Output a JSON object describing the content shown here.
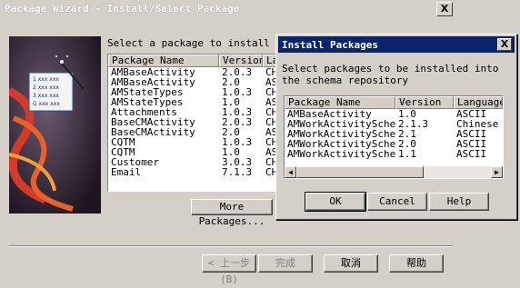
{
  "wizard": {
    "title": "Package Wizard - Install/Select Package",
    "prompt": "Select a package to install into your",
    "columns": [
      "Package Name",
      "Version",
      "La"
    ],
    "rows": [
      [
        "AMBaseActivity",
        "2.0.3",
        "CH"
      ],
      [
        "AMBaseActivity",
        "2.0",
        "AS"
      ],
      [
        "AMStateTypes",
        "1.0.3",
        "CH"
      ],
      [
        "AMStateTypes",
        "1.0",
        "AS"
      ],
      [
        "Attachments",
        "1.0.3",
        "CH"
      ],
      [
        "BaseCMActivity",
        "2.0.3",
        "CH"
      ],
      [
        "BaseCMActivity",
        "2.0",
        "AS"
      ],
      [
        "CQTM",
        "1.0.3",
        "CH"
      ],
      [
        "CQTM",
        "1.0",
        "AS"
      ],
      [
        "Customer",
        "3.0.3",
        "CH"
      ],
      [
        "Email",
        "7.1.3",
        "CH"
      ]
    ],
    "more_packages_label": "More Packages...",
    "back_label": "< 上一步(B)",
    "finish_label": "完成",
    "cancel_label": "取消",
    "help_label": "帮助",
    "close_symbol": "X",
    "art_lines": [
      "1 xxx xxx",
      "2 xxx xxx",
      "3 xxx xxx",
      "G xxx xxx"
    ]
  },
  "install_dialog": {
    "title": "Install Packages",
    "message": "Select packages to be installed into the schema repository",
    "columns": [
      "Package Name",
      "Version",
      "Language"
    ],
    "rows": [
      [
        "AMBaseActivity",
        "1.0",
        "ASCII"
      ],
      [
        "AMWorkActivitySchedule",
        "2.1.3",
        "Chinese"
      ],
      [
        "AMWorkActivitySchedule",
        "2.1",
        "ASCII"
      ],
      [
        "AMWorkActivitySchedule",
        "2.0",
        "ASCII"
      ],
      [
        "AMWorkActivitySchedule",
        "1.1",
        "ASCII"
      ]
    ],
    "ok_label": "OK",
    "cancel_label": "Cancel",
    "help_label": "Help",
    "close_symbol": "X",
    "scroll_left": "◀",
    "scroll_right": "▶"
  },
  "colors": {
    "face": "#d4d0c8",
    "caption": "#0a246a",
    "shadow": "#808080"
  }
}
